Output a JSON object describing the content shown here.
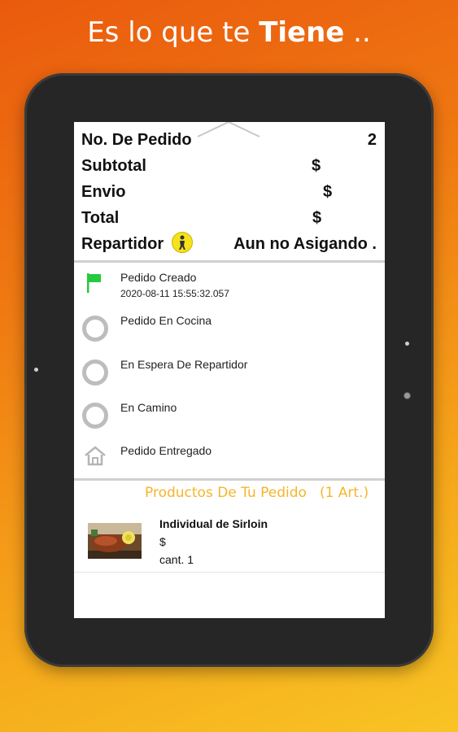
{
  "promo": {
    "before": "Es lo que te ",
    "bold": "Tiene",
    "after": " .."
  },
  "order": {
    "number_label": "No. De Pedido",
    "number_value": "2",
    "subtotal_label": "Subtotal",
    "subtotal_value": "$",
    "envio_label": "Envio",
    "envio_value": "$",
    "total_label": "Total",
    "total_value": "$",
    "repartidor_label": "Repartidor",
    "repartidor_value": "Aun no Asigando ."
  },
  "steps": [
    {
      "title": "Pedido Creado",
      "timestamp": "2020-08-11 15:55:32.057",
      "icon": "flag-icon",
      "done": true
    },
    {
      "title": "Pedido En Cocina",
      "icon": "circle-icon",
      "done": false
    },
    {
      "title": "En Espera De Repartidor",
      "icon": "circle-icon",
      "done": false
    },
    {
      "title": "En Camino",
      "icon": "circle-icon",
      "done": false
    },
    {
      "title": "Pedido Entregado",
      "icon": "house-icon",
      "done": false
    }
  ],
  "products": {
    "header": "Productos De Tu Pedido",
    "count": "(1 Art.)",
    "items": [
      {
        "name": "Individual de Sirloin",
        "price": "$",
        "qty": "cant. 1"
      }
    ]
  },
  "colors": {
    "accent": "#f5b52a",
    "flag": "#27c93f",
    "ring": "#bdbdbd",
    "background_top": "#ea5a0e",
    "background_bottom": "#f8c424"
  }
}
